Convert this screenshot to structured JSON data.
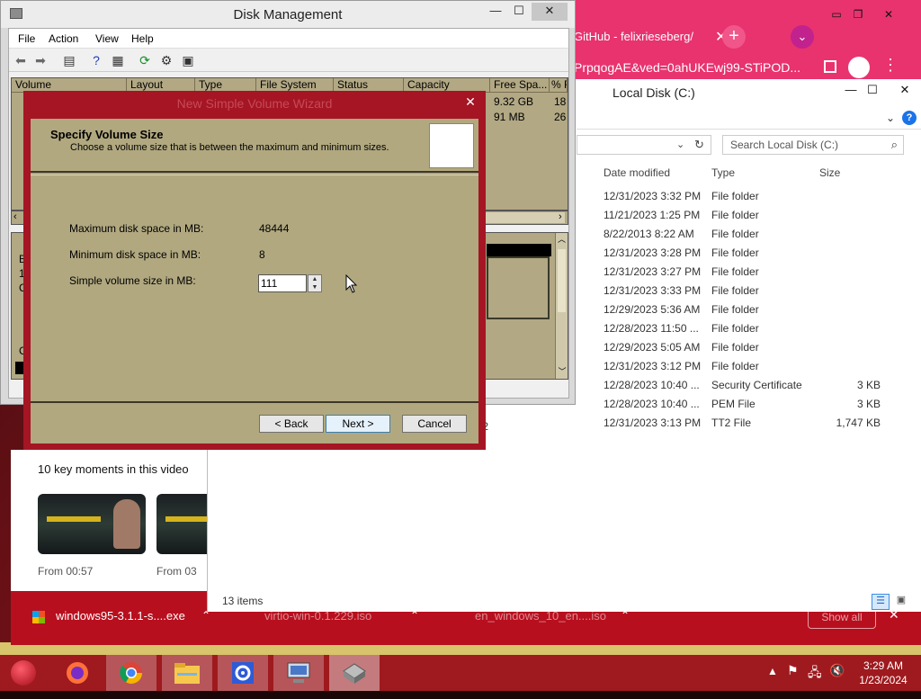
{
  "chrome": {
    "tab_title": "GitHub - felixrieseberg/",
    "url_text": "PrpqogAE&ved=0ahUKEwj99-STiPOD..."
  },
  "youtube": {
    "key_moments_title": "10 key moments in this video",
    "moments": [
      {
        "label": "From 00:57"
      },
      {
        "label": "From 03"
      }
    ]
  },
  "downloads": {
    "items": [
      {
        "name": "windows95-3.1.1-s....exe"
      },
      {
        "name": "virtio-win-0.1.229.iso"
      },
      {
        "name": "en_windows_10_en....iso"
      }
    ],
    "show_all_label": "Show all"
  },
  "explorer": {
    "title": "Local Disk (C:)",
    "search_placeholder": "Search Local Disk (C:)",
    "columns": {
      "date": "Date modified",
      "type": "Type",
      "size": "Size"
    },
    "rows": [
      {
        "date": "12/31/2023 3:32 PM",
        "type": "File folder",
        "size": ""
      },
      {
        "date": "11/21/2023 1:25 PM",
        "type": "File folder",
        "size": ""
      },
      {
        "date": "8/22/2013 8:22 AM",
        "type": "File folder",
        "size": ""
      },
      {
        "date": "12/31/2023 3:28 PM",
        "type": "File folder",
        "size": ""
      },
      {
        "date": "12/31/2023 3:27 PM",
        "type": "File folder",
        "size": ""
      },
      {
        "date": "12/31/2023 3:33 PM",
        "type": "File folder",
        "size": ""
      },
      {
        "date": "12/29/2023 5:36 AM",
        "type": "File folder",
        "size": ""
      },
      {
        "date": "12/28/2023 11:50 ...",
        "type": "File folder",
        "size": ""
      },
      {
        "date": "12/29/2023 5:05 AM",
        "type": "File folder",
        "size": ""
      },
      {
        "date": "12/31/2023 3:12 PM",
        "type": "File folder",
        "size": ""
      },
      {
        "date": "12/28/2023 10:40 ...",
        "type": "Security Certificate",
        "size": "3 KB"
      },
      {
        "date": "12/28/2023 10:40 ...",
        "type": "PEM File",
        "size": "3 KB"
      },
      {
        "date": "12/31/2023 3:13 PM",
        "type": "TT2 File",
        "size": "1,747 KB"
      }
    ],
    "partial_name": "t2",
    "status": "13 items"
  },
  "disk_mgmt": {
    "title": "Disk Management",
    "menu": [
      "File",
      "Action",
      "View",
      "Help"
    ],
    "columns": [
      "Volume",
      "Layout",
      "Type",
      "File System",
      "Status",
      "Capacity",
      "Free Spa...",
      "% F"
    ],
    "rows": [
      {
        "free": "9.32 GB",
        "pct": "18"
      },
      {
        "free": "91 MB",
        "pct": "26"
      }
    ],
    "graph_partial": [
      "B",
      "1",
      "C",
      "C"
    ]
  },
  "wizard": {
    "title": "New Simple Volume Wizard",
    "header_title": "Specify Volume Size",
    "header_subtitle": "Choose a volume size that is between the maximum and minimum sizes.",
    "max_label": "Maximum disk space in MB:",
    "max_value": "48444",
    "min_label": "Minimum disk space in MB:",
    "min_value": "8",
    "size_label": "Simple volume size in MB:",
    "size_value": "111",
    "back_label": "< Back",
    "next_label": "Next >",
    "cancel_label": "Cancel"
  },
  "taskbar": {
    "time": "3:29 AM",
    "date": "1/23/2024"
  },
  "colors": {
    "accent_red": "#a51523",
    "wizard_khaki": "#b1a880",
    "chrome_pink": "#e8336f"
  }
}
